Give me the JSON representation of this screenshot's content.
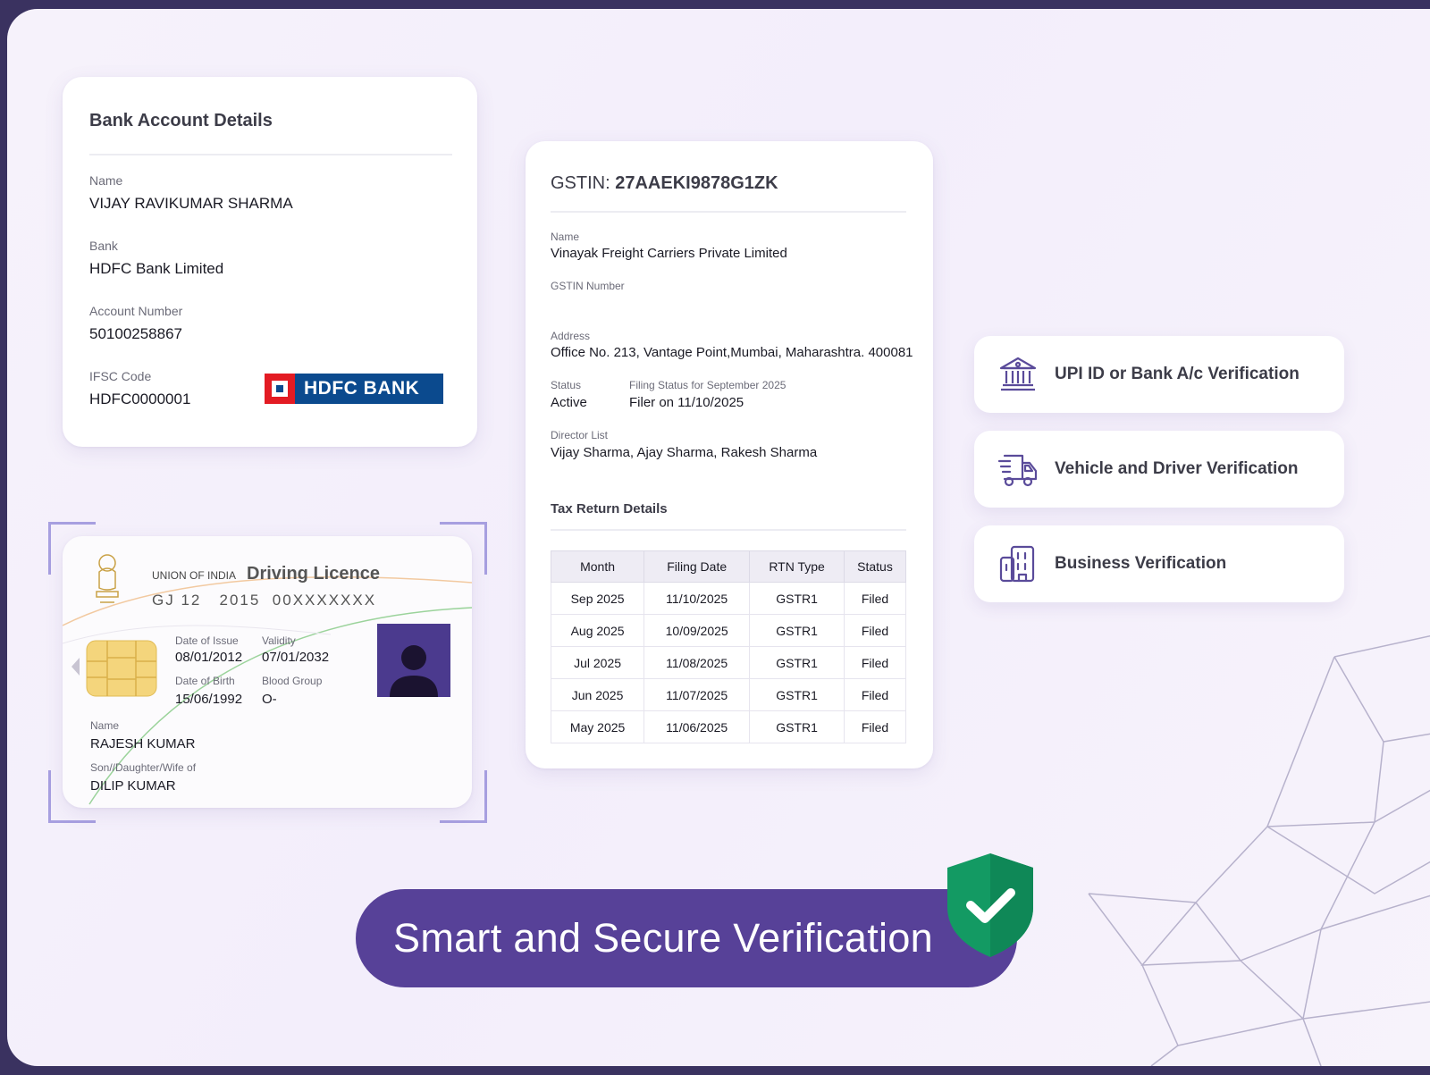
{
  "bank": {
    "title": "Bank Account Details",
    "name_label": "Name",
    "name_value": "VIJAY RAVIKUMAR SHARMA",
    "bank_label": "Bank",
    "bank_value": "HDFC Bank Limited",
    "account_label": "Account Number",
    "account_value": "50100258867",
    "ifsc_label": "IFSC Code",
    "ifsc_value": "HDFC0000001",
    "logo_text": "HDFC BANK"
  },
  "gst": {
    "title_prefix": "GSTIN:",
    "title_value": "27AAEKI9878G1ZK",
    "name_label": "Name",
    "name_value": "Vinayak Freight Carriers Private Limited",
    "gstin_label": "GSTIN Number",
    "address_label": "Address",
    "address_value": "Office No. 213, Vantage Point,Mumbai, Maharashtra. 400081",
    "status_label": "Status",
    "status_value": "Active",
    "filing_label": "Filing Status for September 2025",
    "filing_value": "Filer on 11/10/2025",
    "director_label": "Director List",
    "director_value": "Vijay Sharma, Ajay Sharma, Rakesh Sharma",
    "tax_title": "Tax Return Details",
    "table_headers": [
      "Month",
      "Filing Date",
      "RTN Type",
      "Status"
    ],
    "table_rows": [
      [
        "Sep 2025",
        "11/10/2025",
        "GSTR1",
        "Filed"
      ],
      [
        "Aug 2025",
        "10/09/2025",
        "GSTR1",
        "Filed"
      ],
      [
        "Jul 2025",
        "11/08/2025",
        "GSTR1",
        "Filed"
      ],
      [
        "Jun 2025",
        "11/07/2025",
        "GSTR1",
        "Filed"
      ],
      [
        "May 2025",
        "11/06/2025",
        "GSTR1",
        "Filed"
      ]
    ]
  },
  "licence": {
    "issuer": "UNION OF INDIA",
    "title": "Driving Licence",
    "number": "GJ 12   2015  00XXXXXXX",
    "issue_label": "Date of Issue",
    "issue_value": "08/01/2012",
    "validity_label": "Validity",
    "validity_value": "07/01/2032",
    "dob_label": "Date of Birth",
    "dob_value": "15/06/1992",
    "blood_label": "Blood Group",
    "blood_value": "O-",
    "name_label": "Name",
    "name_value": "RAJESH KUMAR",
    "relation_label": "Son//Daughter/Wife of",
    "relation_value": "DILIP KUMAR"
  },
  "features": [
    {
      "label": "UPI ID or Bank A/c Verification",
      "icon": "bank-building-icon"
    },
    {
      "label": "Vehicle and Driver Verification",
      "icon": "truck-icon"
    },
    {
      "label": "Business Verification",
      "icon": "office-building-icon"
    }
  ],
  "banner": {
    "text": "Smart and Secure Verification",
    "icon": "shield-check-icon"
  },
  "colors": {
    "accent": "#574198",
    "shield": "#139a63",
    "frame": "#3a3260"
  }
}
